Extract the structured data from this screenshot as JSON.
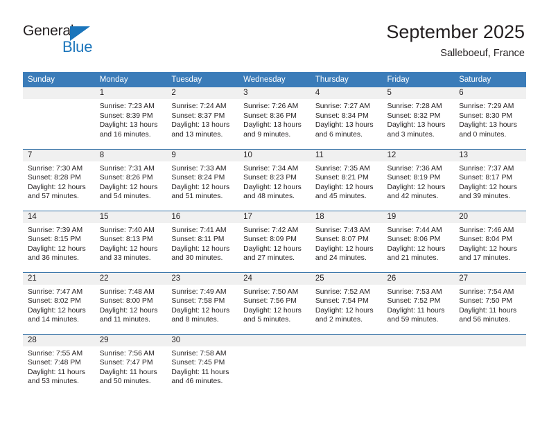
{
  "brand": {
    "name_part1": "General",
    "name_part2": "Blue",
    "triangle_color": "#1b75bb"
  },
  "header": {
    "title": "September 2025",
    "location": "Salleboeuf, France",
    "header_bg": "#3b7cb9",
    "row_divider_color": "#2e6da4",
    "daynum_band_bg": "#f0f0f0"
  },
  "weekdays": [
    "Sunday",
    "Monday",
    "Tuesday",
    "Wednesday",
    "Thursday",
    "Friday",
    "Saturday"
  ],
  "labels": {
    "sunrise": "Sunrise:",
    "sunset": "Sunset:",
    "daylight": "Daylight:"
  },
  "weeks": [
    [
      {
        "day": "",
        "empty": true
      },
      {
        "day": "1",
        "sunrise": "Sunrise: 7:23 AM",
        "sunset": "Sunset: 8:39 PM",
        "daylight_line1": "Daylight: 13 hours",
        "daylight_line2": "and 16 minutes."
      },
      {
        "day": "2",
        "sunrise": "Sunrise: 7:24 AM",
        "sunset": "Sunset: 8:37 PM",
        "daylight_line1": "Daylight: 13 hours",
        "daylight_line2": "and 13 minutes."
      },
      {
        "day": "3",
        "sunrise": "Sunrise: 7:26 AM",
        "sunset": "Sunset: 8:36 PM",
        "daylight_line1": "Daylight: 13 hours",
        "daylight_line2": "and 9 minutes."
      },
      {
        "day": "4",
        "sunrise": "Sunrise: 7:27 AM",
        "sunset": "Sunset: 8:34 PM",
        "daylight_line1": "Daylight: 13 hours",
        "daylight_line2": "and 6 minutes."
      },
      {
        "day": "5",
        "sunrise": "Sunrise: 7:28 AM",
        "sunset": "Sunset: 8:32 PM",
        "daylight_line1": "Daylight: 13 hours",
        "daylight_line2": "and 3 minutes."
      },
      {
        "day": "6",
        "sunrise": "Sunrise: 7:29 AM",
        "sunset": "Sunset: 8:30 PM",
        "daylight_line1": "Daylight: 13 hours",
        "daylight_line2": "and 0 minutes."
      }
    ],
    [
      {
        "day": "7",
        "sunrise": "Sunrise: 7:30 AM",
        "sunset": "Sunset: 8:28 PM",
        "daylight_line1": "Daylight: 12 hours",
        "daylight_line2": "and 57 minutes."
      },
      {
        "day": "8",
        "sunrise": "Sunrise: 7:31 AM",
        "sunset": "Sunset: 8:26 PM",
        "daylight_line1": "Daylight: 12 hours",
        "daylight_line2": "and 54 minutes."
      },
      {
        "day": "9",
        "sunrise": "Sunrise: 7:33 AM",
        "sunset": "Sunset: 8:24 PM",
        "daylight_line1": "Daylight: 12 hours",
        "daylight_line2": "and 51 minutes."
      },
      {
        "day": "10",
        "sunrise": "Sunrise: 7:34 AM",
        "sunset": "Sunset: 8:23 PM",
        "daylight_line1": "Daylight: 12 hours",
        "daylight_line2": "and 48 minutes."
      },
      {
        "day": "11",
        "sunrise": "Sunrise: 7:35 AM",
        "sunset": "Sunset: 8:21 PM",
        "daylight_line1": "Daylight: 12 hours",
        "daylight_line2": "and 45 minutes."
      },
      {
        "day": "12",
        "sunrise": "Sunrise: 7:36 AM",
        "sunset": "Sunset: 8:19 PM",
        "daylight_line1": "Daylight: 12 hours",
        "daylight_line2": "and 42 minutes."
      },
      {
        "day": "13",
        "sunrise": "Sunrise: 7:37 AM",
        "sunset": "Sunset: 8:17 PM",
        "daylight_line1": "Daylight: 12 hours",
        "daylight_line2": "and 39 minutes."
      }
    ],
    [
      {
        "day": "14",
        "sunrise": "Sunrise: 7:39 AM",
        "sunset": "Sunset: 8:15 PM",
        "daylight_line1": "Daylight: 12 hours",
        "daylight_line2": "and 36 minutes."
      },
      {
        "day": "15",
        "sunrise": "Sunrise: 7:40 AM",
        "sunset": "Sunset: 8:13 PM",
        "daylight_line1": "Daylight: 12 hours",
        "daylight_line2": "and 33 minutes."
      },
      {
        "day": "16",
        "sunrise": "Sunrise: 7:41 AM",
        "sunset": "Sunset: 8:11 PM",
        "daylight_line1": "Daylight: 12 hours",
        "daylight_line2": "and 30 minutes."
      },
      {
        "day": "17",
        "sunrise": "Sunrise: 7:42 AM",
        "sunset": "Sunset: 8:09 PM",
        "daylight_line1": "Daylight: 12 hours",
        "daylight_line2": "and 27 minutes."
      },
      {
        "day": "18",
        "sunrise": "Sunrise: 7:43 AM",
        "sunset": "Sunset: 8:07 PM",
        "daylight_line1": "Daylight: 12 hours",
        "daylight_line2": "and 24 minutes."
      },
      {
        "day": "19",
        "sunrise": "Sunrise: 7:44 AM",
        "sunset": "Sunset: 8:06 PM",
        "daylight_line1": "Daylight: 12 hours",
        "daylight_line2": "and 21 minutes."
      },
      {
        "day": "20",
        "sunrise": "Sunrise: 7:46 AM",
        "sunset": "Sunset: 8:04 PM",
        "daylight_line1": "Daylight: 12 hours",
        "daylight_line2": "and 17 minutes."
      }
    ],
    [
      {
        "day": "21",
        "sunrise": "Sunrise: 7:47 AM",
        "sunset": "Sunset: 8:02 PM",
        "daylight_line1": "Daylight: 12 hours",
        "daylight_line2": "and 14 minutes."
      },
      {
        "day": "22",
        "sunrise": "Sunrise: 7:48 AM",
        "sunset": "Sunset: 8:00 PM",
        "daylight_line1": "Daylight: 12 hours",
        "daylight_line2": "and 11 minutes."
      },
      {
        "day": "23",
        "sunrise": "Sunrise: 7:49 AM",
        "sunset": "Sunset: 7:58 PM",
        "daylight_line1": "Daylight: 12 hours",
        "daylight_line2": "and 8 minutes."
      },
      {
        "day": "24",
        "sunrise": "Sunrise: 7:50 AM",
        "sunset": "Sunset: 7:56 PM",
        "daylight_line1": "Daylight: 12 hours",
        "daylight_line2": "and 5 minutes."
      },
      {
        "day": "25",
        "sunrise": "Sunrise: 7:52 AM",
        "sunset": "Sunset: 7:54 PM",
        "daylight_line1": "Daylight: 12 hours",
        "daylight_line2": "and 2 minutes."
      },
      {
        "day": "26",
        "sunrise": "Sunrise: 7:53 AM",
        "sunset": "Sunset: 7:52 PM",
        "daylight_line1": "Daylight: 11 hours",
        "daylight_line2": "and 59 minutes."
      },
      {
        "day": "27",
        "sunrise": "Sunrise: 7:54 AM",
        "sunset": "Sunset: 7:50 PM",
        "daylight_line1": "Daylight: 11 hours",
        "daylight_line2": "and 56 minutes."
      }
    ],
    [
      {
        "day": "28",
        "sunrise": "Sunrise: 7:55 AM",
        "sunset": "Sunset: 7:48 PM",
        "daylight_line1": "Daylight: 11 hours",
        "daylight_line2": "and 53 minutes."
      },
      {
        "day": "29",
        "sunrise": "Sunrise: 7:56 AM",
        "sunset": "Sunset: 7:47 PM",
        "daylight_line1": "Daylight: 11 hours",
        "daylight_line2": "and 50 minutes."
      },
      {
        "day": "30",
        "sunrise": "Sunrise: 7:58 AM",
        "sunset": "Sunset: 7:45 PM",
        "daylight_line1": "Daylight: 11 hours",
        "daylight_line2": "and 46 minutes."
      },
      {
        "day": "",
        "empty": true
      },
      {
        "day": "",
        "empty": true
      },
      {
        "day": "",
        "empty": true
      },
      {
        "day": "",
        "empty": true
      }
    ]
  ]
}
